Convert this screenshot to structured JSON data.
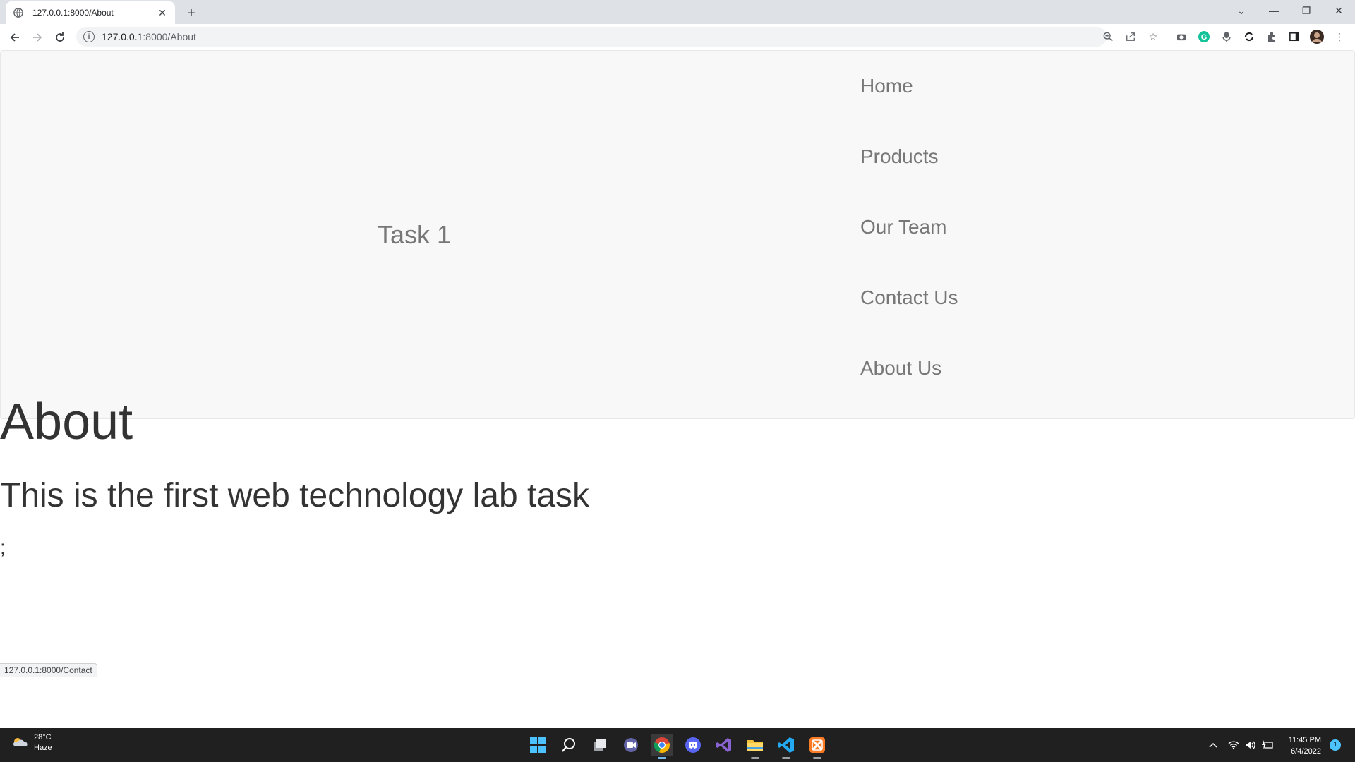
{
  "browser": {
    "tab_title": "127.0.0.1:8000/About",
    "url_host": "127.0.0.1",
    "url_rest": ":8000/About",
    "status_url": "127.0.0.1:8000/Contact"
  },
  "page": {
    "brand": "Task 1",
    "nav": [
      "Home",
      "Products",
      "Our Team",
      "Contact Us",
      "About Us"
    ],
    "heading": "About",
    "paragraph": "This is the first web technology lab task",
    "trailing": ";"
  },
  "taskbar": {
    "temperature": "28°C",
    "weather": "Haze",
    "time": "11:45 PM",
    "date": "6/4/2022",
    "notifications": "1"
  },
  "icons": {
    "favicon": "globe-icon",
    "back": "arrow-left-icon",
    "forward": "arrow-right-icon",
    "reload": "reload-icon",
    "site_info": "info-icon"
  }
}
